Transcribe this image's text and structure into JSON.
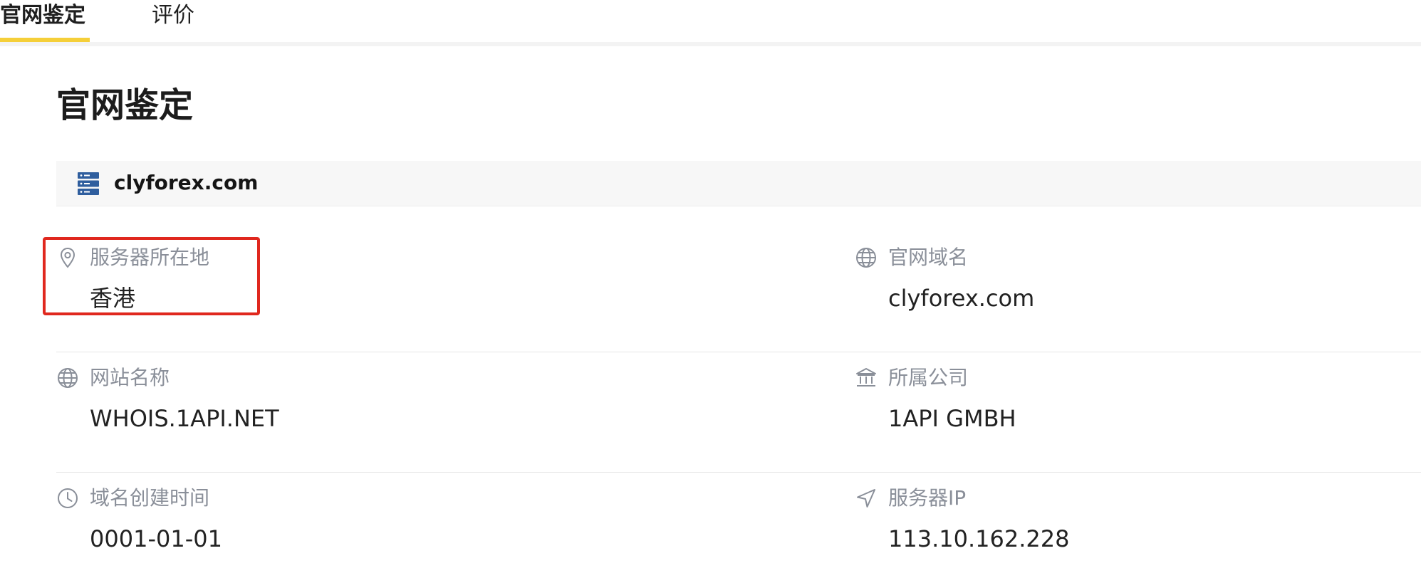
{
  "tabs": [
    {
      "label": "官网鉴定",
      "active": true
    },
    {
      "label": "评价",
      "active": false
    }
  ],
  "colors": {
    "accent": "#f5cf39",
    "highlight": "#e0281e",
    "label": "#8a8f99",
    "icon": "#3a6fb0"
  },
  "main": {
    "title": "官网鉴定",
    "domain": {
      "icon": "server-icon",
      "text": "clyforex.com"
    },
    "info": [
      {
        "icon": "location-pin-icon",
        "label": "服务器所在地",
        "value": "香港",
        "highlighted": true
      },
      {
        "icon": "globe-icon",
        "label": "官网域名",
        "value": "clyforex.com"
      },
      {
        "icon": "globe-icon",
        "label": "网站名称",
        "value": "WHOIS.1API.NET"
      },
      {
        "icon": "bank-icon",
        "label": "所属公司",
        "value": "1API GMBH"
      },
      {
        "icon": "clock-icon",
        "label": "域名创建时间",
        "value": "0001-01-01"
      },
      {
        "icon": "navigation-arrow-icon",
        "label": "服务器IP",
        "value": "113.10.162.228"
      }
    ]
  }
}
